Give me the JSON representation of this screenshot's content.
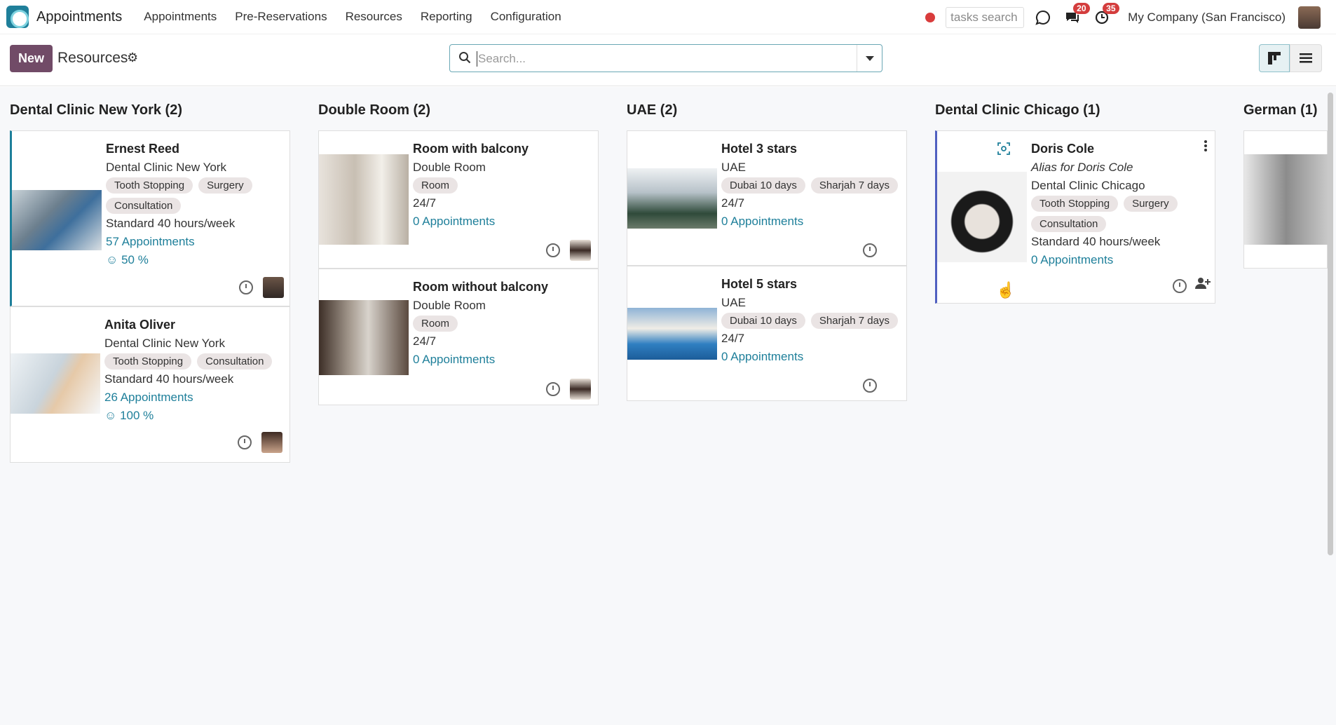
{
  "app": {
    "title": "Appointments"
  },
  "menu": [
    "Appointments",
    "Pre-Reservations",
    "Resources",
    "Reporting",
    "Configuration"
  ],
  "topbar": {
    "tasks_search": "tasks search",
    "messages_count": "20",
    "activities_count": "35",
    "company": "My Company (San Francisco)"
  },
  "control": {
    "new_label": "New",
    "breadcrumb": "Resources",
    "search_placeholder": "Search..."
  },
  "columns": [
    {
      "title": "Dental Clinic New York (2)",
      "cards": [
        {
          "name": "Ernest Reed",
          "subtitle": "Dental Clinic New York",
          "tags": [
            "Tooth Stopping",
            "Surgery",
            "Consultation"
          ],
          "hours": "Standard 40 hours/week",
          "appointments": "57 Appointments",
          "rating": "☺ 50 %"
        },
        {
          "name": "Anita Oliver",
          "subtitle": "Dental Clinic New York",
          "tags": [
            "Tooth Stopping",
            "Consultation"
          ],
          "hours": "Standard 40 hours/week",
          "appointments": "26 Appointments",
          "rating": "☺ 100 %"
        }
      ]
    },
    {
      "title": "Double Room (2)",
      "cards": [
        {
          "name": "Room with balcony",
          "subtitle": "Double Room",
          "tags": [
            "Room"
          ],
          "hours": "24/7",
          "appointments": "0 Appointments"
        },
        {
          "name": "Room without balcony",
          "subtitle": "Double Room",
          "tags": [
            "Room"
          ],
          "hours": "24/7",
          "appointments": "0 Appointments"
        }
      ]
    },
    {
      "title": "UAE (2)",
      "cards": [
        {
          "name": "Hotel 3 stars",
          "subtitle": "UAE",
          "tags": [
            "Dubai 10 days",
            "Sharjah 7 days"
          ],
          "hours": "24/7",
          "appointments": "0 Appointments"
        },
        {
          "name": "Hotel 5 stars",
          "subtitle": "UAE",
          "tags": [
            "Dubai 10 days",
            "Sharjah 7 days"
          ],
          "hours": "24/7",
          "appointments": "0 Appointments"
        }
      ]
    },
    {
      "title": "Dental Clinic Chicago (1)",
      "cards": [
        {
          "name": "Doris Cole",
          "alias": "Alias for Doris Cole",
          "subtitle": "Dental Clinic Chicago",
          "tags": [
            "Tooth Stopping",
            "Surgery",
            "Consultation"
          ],
          "hours": "Standard 40 hours/week",
          "appointments": "0 Appointments"
        }
      ]
    },
    {
      "title": "German (1)",
      "cards": []
    }
  ],
  "colors": {
    "brand": "#714b67",
    "accent": "#1e7f9a",
    "badge": "#d43d3d"
  },
  "icons": [
    "search-icon",
    "gear-icon",
    "chat-icon",
    "messages-icon",
    "activity-clock-icon",
    "kanban-view-icon",
    "list-view-icon",
    "clock-icon",
    "add-user-icon",
    "kebab-menu-icon",
    "face-scan-icon"
  ]
}
